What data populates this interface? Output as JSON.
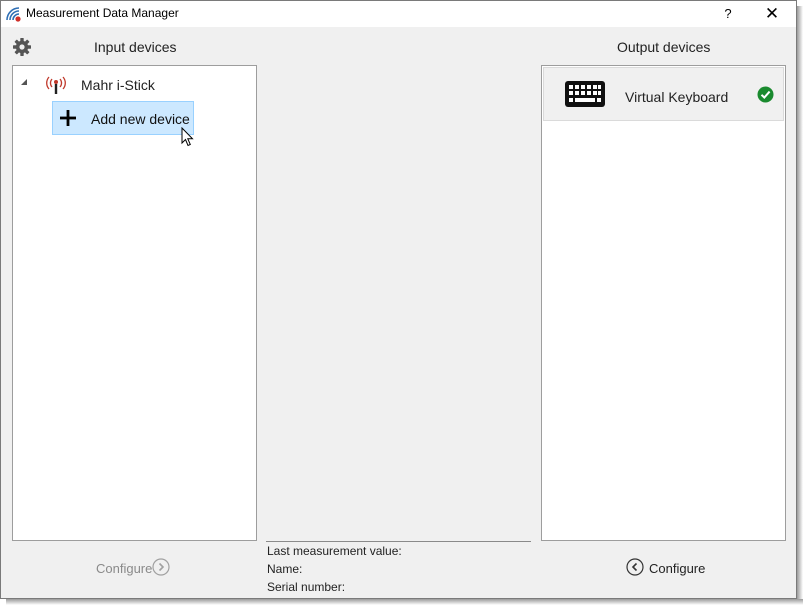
{
  "window": {
    "title": "Measurement Data Manager",
    "help_label": "?",
    "close_label": "✕",
    "app_icon": "wireless-signal-icon"
  },
  "input": {
    "title": "Input devices",
    "settings_icon": "gear-icon",
    "tree": {
      "expander_icon": "expanded-triangle-icon",
      "device": {
        "label": "Mahr i-Stick",
        "icon": "radio-antenna-icon"
      },
      "add_item": {
        "label": "Add new device",
        "icon": "plus-icon"
      }
    },
    "configure_label": "Configure",
    "configure_icon": "chevron-right-circle-icon"
  },
  "output": {
    "title": "Output devices",
    "items": [
      {
        "label": "Virtual Keyboard",
        "icon": "keyboard-icon",
        "status_icon": "check-circle-icon",
        "status_color": "#1a8a2e"
      }
    ],
    "configure_label": "Configure",
    "configure_icon": "chevron-left-circle-icon"
  },
  "info": {
    "last_measurement_label": "Last measurement value:",
    "name_label": "Name:",
    "serial_label": "Serial number:"
  },
  "colors": {
    "selection_bg": "#cce8ff",
    "selection_border": "#99d1ff",
    "antenna_red": "#c0392b"
  }
}
